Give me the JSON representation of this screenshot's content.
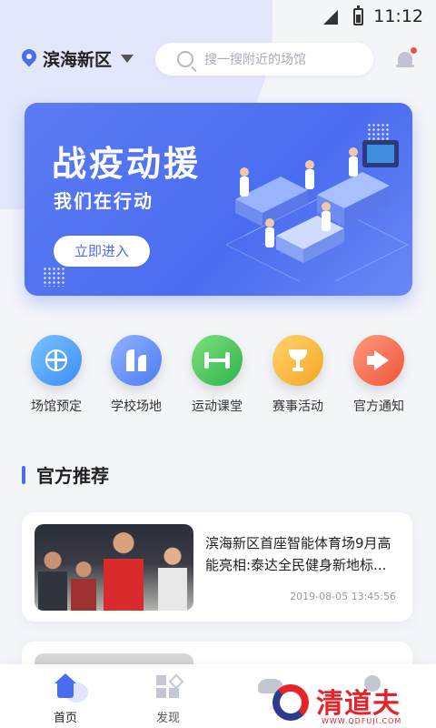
{
  "status_bar": {
    "time": "11:12"
  },
  "header": {
    "location": "滨海新区",
    "search_placeholder": "搜一搜附近的场馆"
  },
  "banner": {
    "title": "战疫动援",
    "subtitle": "我们在行动",
    "button_label": "立即进入"
  },
  "categories": [
    {
      "label": "场馆预定",
      "icon": "basketball-icon",
      "color": "#3b8ef5"
    },
    {
      "label": "学校场地",
      "icon": "school-icon",
      "color": "#4d7cf5"
    },
    {
      "label": "运动课堂",
      "icon": "dumbbell-icon",
      "color": "#2eb34c"
    },
    {
      "label": "赛事活动",
      "icon": "trophy-icon",
      "color": "#f5a623"
    },
    {
      "label": "官方通知",
      "icon": "megaphone-icon",
      "color": "#f0533d"
    }
  ],
  "section": {
    "title": "官方推荐"
  },
  "news": [
    {
      "title": "滨海新区首座智能体育场9月高能亮相:泰达全民健身新地标...",
      "time": "2019-08-05   13:45:56"
    }
  ],
  "bottom_nav": [
    {
      "label": "首页",
      "icon": "home-icon",
      "active": true
    },
    {
      "label": "发现",
      "icon": "discover-icon",
      "active": false
    }
  ],
  "watermark": {
    "text": "清道夫",
    "url": "WWW.QDFUJI.COM"
  },
  "colors": {
    "accent": "#4a6cf0",
    "background": "#f4f5f9",
    "notification_dot": "#f0533d"
  }
}
